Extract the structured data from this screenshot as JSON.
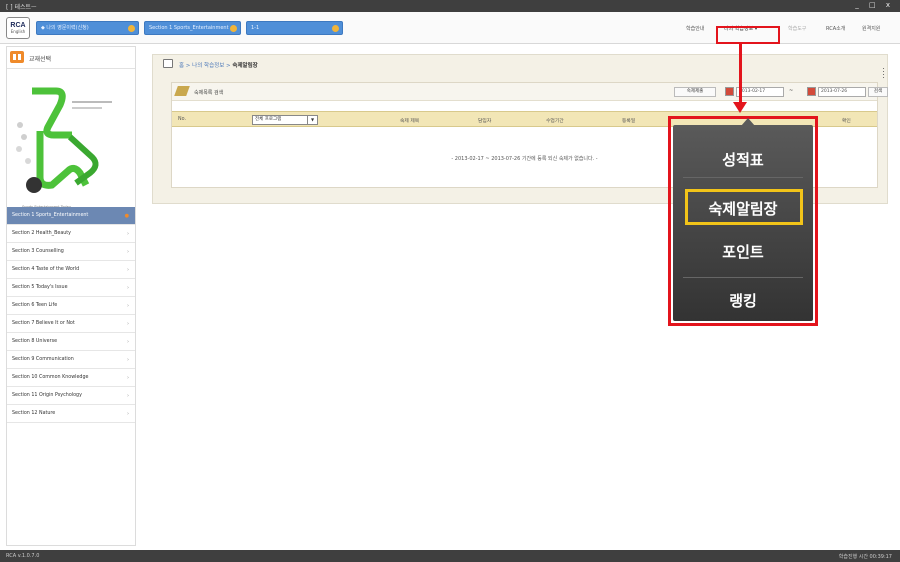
{
  "window": {
    "title": "[ ] 테스트ㅡ",
    "controls": "_ □ x"
  },
  "header": {
    "logo_main": "RCA",
    "logo_sub": "English",
    "selects": [
      "◆ 나의 영문이력(신청)",
      "Section 1 Sports_Entertainment",
      "1-1"
    ],
    "nav": {
      "item1": "학습안내",
      "item2": "나의 학습정보",
      "item3": "학습도구",
      "item4": "RCA소개",
      "item5": "원격지원"
    }
  },
  "sidebar": {
    "title": "교재선택",
    "cover_caption": "Sports Entertainment Today",
    "sections": [
      "Section 1 Sports_Entertainment",
      "Section 2 Health_Beauty",
      "Section 3 Counselling",
      "Section 4 Taste of the World",
      "Section 5 Today's Issue",
      "Section 6 Teen Life",
      "Section 7 Believe It or Not",
      "Section 8 Universe",
      "Section 9 Communication",
      "Section 10 Common Knowledge",
      "Section 11 Origin Psychology",
      "Section 12 Nature"
    ]
  },
  "main": {
    "breadcrumb": {
      "home": "홈",
      "sep": " > ",
      "parent": "나의 학습정보",
      "current": "숙제알림장"
    },
    "panel_title": "숙제목록 검색",
    "submit_button": "숙제제출",
    "date_from": "2013-02-17",
    "date_to": "2013-07-26",
    "tilde": "~",
    "search_button": "검색",
    "columns": {
      "no": "No.",
      "filter": "전체 프로그램",
      "subject": "숙제 제목",
      "teacher": "담임자",
      "period": "수업기간",
      "submitted": "등록일",
      "confirm": "확인"
    },
    "empty_message": "- 2013-02-17 ~ 2013-07-26 기간에 등록 되신 숙제가 없습니다. -"
  },
  "popup": {
    "items": [
      "성적표",
      "숙제알림장",
      "포인트",
      "랭킹"
    ],
    "selected_index": 1
  },
  "status": {
    "version": "RCA v.1.0.7.0",
    "time": "학습진행 시간 00:39:17"
  },
  "colors": {
    "highlight_red": "#e3141c",
    "highlight_yellow": "#f2c419",
    "select_blue": "#4f8fd8",
    "active_section": "#6c88b3",
    "table_header": "#f2e6b6"
  }
}
